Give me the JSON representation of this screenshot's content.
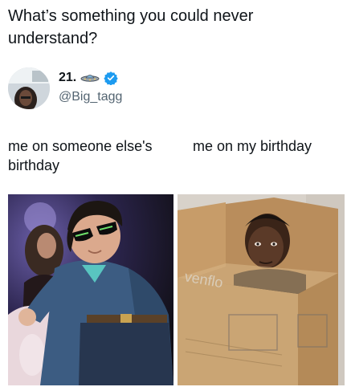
{
  "post": {
    "question": "What’s something you could never understand?"
  },
  "author": {
    "display_name": "21.",
    "emoji_icon": "ufo-icon",
    "handle": "@Big_tagg",
    "verified_color": "#1d9bf0"
  },
  "meme": {
    "left_caption": "me on someone else's birthday",
    "right_caption": "me on my birthday",
    "box_print": "venflo"
  }
}
